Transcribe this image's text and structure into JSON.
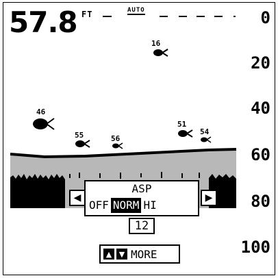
{
  "header": {
    "depth_value": "57.8",
    "depth_unit": "FT",
    "range_mode": "AUTO"
  },
  "depth_scale": [
    "0",
    "20",
    "40",
    "60",
    "80",
    "100"
  ],
  "fish_targets": [
    {
      "depth_label": "16",
      "icon": "fish-symbol",
      "size": "small"
    },
    {
      "depth_label": "46",
      "icon": "fish-symbol",
      "size": "large"
    },
    {
      "depth_label": "55",
      "icon": "fish-symbol",
      "size": "small"
    },
    {
      "depth_label": "56",
      "icon": "fish-symbol",
      "size": "tiny"
    },
    {
      "depth_label": "51",
      "icon": "fish-symbol",
      "size": "small"
    },
    {
      "depth_label": "54",
      "icon": "fish-symbol",
      "size": "tiny"
    }
  ],
  "asp_menu": {
    "title": "ASP",
    "options": [
      "OFF",
      "NORM",
      "HI"
    ],
    "selected": "NORM",
    "value": "12",
    "left_icon": "left-arrow-icon",
    "right_icon": "right-arrow-icon"
  },
  "footer": {
    "keys_icons": [
      "up-arrow-icon",
      "down-arrow-icon"
    ],
    "more_label": "MORE"
  },
  "colors": {
    "background": "#ffffff",
    "ink": "#000000",
    "bottom_fill": "#b8b8b8"
  }
}
